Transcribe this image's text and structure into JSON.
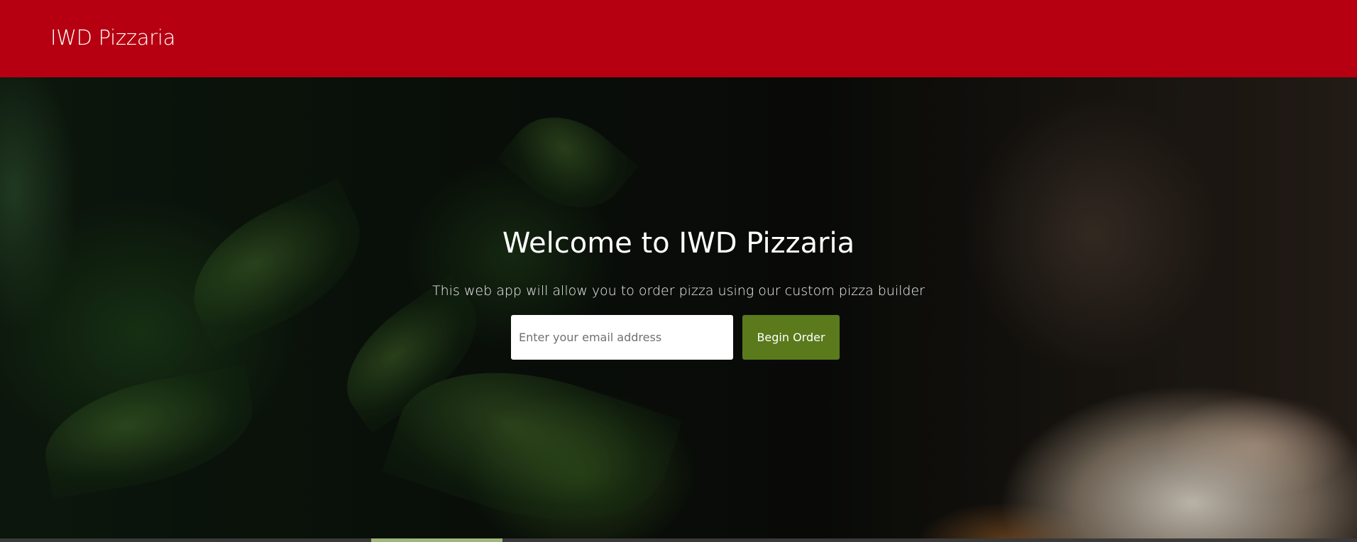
{
  "navbar": {
    "brand": "IWD Pizzaria",
    "background_color": "#b60011"
  },
  "hero": {
    "title": "Welcome to IWD Pizzaria",
    "subtitle": "This web app will allow you to order pizza using our custom pizza builder",
    "email_input": {
      "value": "",
      "placeholder": "Enter your email address"
    },
    "begin_button_label": "Begin Order",
    "begin_button_color": "#5a7a1c",
    "background_image": "basil-and-pizza-photo"
  }
}
